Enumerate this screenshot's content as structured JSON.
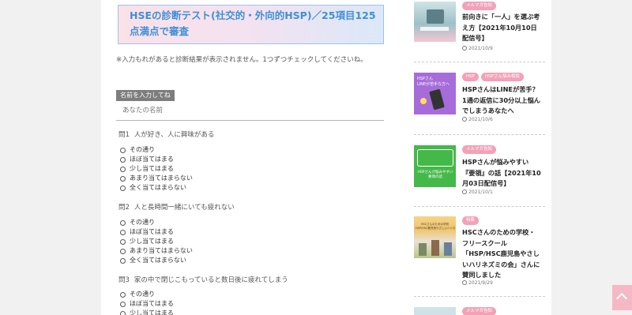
{
  "diagnosis": {
    "title": "HSEの診断テスト(社交的・外向的HSP)／25項目125点満点で審査",
    "note": "※入力もれがあると診断結果が表示されません。1つずつチェックしてくださいね。",
    "name_label": "名前を入力してね",
    "name_placeholder": "あなたの名前",
    "questions": [
      {
        "number": "問1",
        "text": "人が好き、人に興味がある"
      },
      {
        "number": "問2",
        "text": "人と長時間一緒にいても疲れない"
      },
      {
        "number": "問3",
        "text": "家の中で閉じこもっていると数日後に疲れてしまう"
      }
    ],
    "options": [
      "その通り",
      "ほぼ当てはまる",
      "少し当てはまる",
      "あまり当てはまらない",
      "全く当てはまらない"
    ]
  },
  "sidebar": {
    "posts": [
      {
        "tags": [
          "メルマガ告知"
        ],
        "title": "前向きに「一人」を選ぶ考え方【2021年10月10日配信号】",
        "date": "2021/10/9"
      },
      {
        "tags": [
          "HSP",
          "HSPさん悩み相談"
        ],
        "title": "HSPさんはLINEが苦手？1通の返信に30分以上悩んでしまうあなたへ",
        "date": "2021/10/6"
      },
      {
        "tags": [
          "メルマガ告知"
        ],
        "title": "HSPさんが悩みやすい『要領』の話【2021年10月03日配信号】",
        "date": "2021/10/1"
      },
      {
        "tags": [
          "特集"
        ],
        "title": "HSCさんのための学校・フリースクール「HSP/HSC鹿児島やさしいハリネズミの会」さんに賛同しました",
        "date": "2021/9/29"
      },
      {
        "tags": [
          "メルマガ告知"
        ]
      }
    ],
    "thumb_texts": {
      "line": "HSPさん\nLINEが苦手な方へ",
      "hsp_yoryo": "HSPさんが悩みやすい\n要領の話",
      "school": "HSCさんのための学校\nHSP/HSC鹿児島やさしいハリネズミの会"
    }
  },
  "colors": {
    "accent_blue": "#3f8fd8",
    "tag_pink": "#f3a1b8"
  }
}
